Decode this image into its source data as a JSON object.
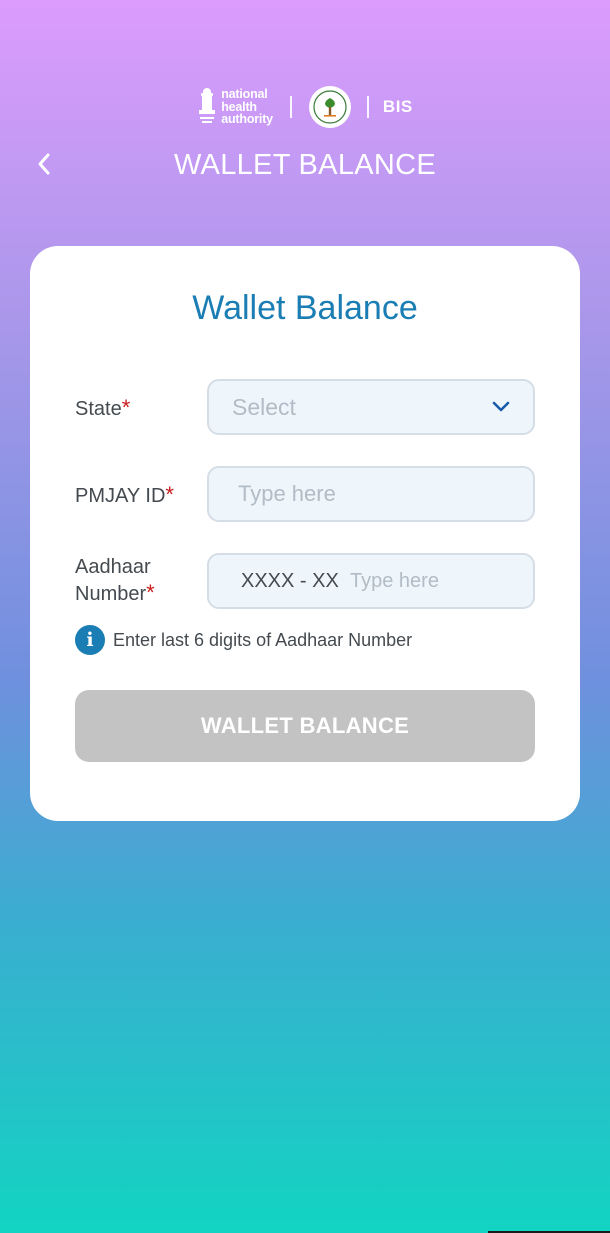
{
  "header": {
    "nha_logo_lines": [
      "national",
      "health",
      "authority"
    ],
    "partner_logo": "bis",
    "bis_label": "BIS",
    "title": "WALLET BALANCE"
  },
  "card": {
    "title": "Wallet Balance",
    "state": {
      "label": "State",
      "required_mark": "*",
      "selected_value": "Select"
    },
    "pmjay": {
      "label": "PMJAY ID",
      "required_mark": "*",
      "placeholder": "Type here"
    },
    "aadhaar": {
      "label_line1": "Aadhaar",
      "label_line2": "Number",
      "required_mark": "*",
      "prefix": "XXXX - XX",
      "placeholder": "Type here"
    },
    "hint": {
      "icon": "info-icon",
      "text": "Enter last 6 digits of Aadhaar Number"
    },
    "submit_label": "WALLET BALANCE"
  },
  "colors": {
    "accent": "#1a7db4",
    "required": "#cc1b1b",
    "button_disabled": "#c3c3c3",
    "gradient_top": "#dc9cfd",
    "gradient_bottom": "#12d4c2"
  }
}
